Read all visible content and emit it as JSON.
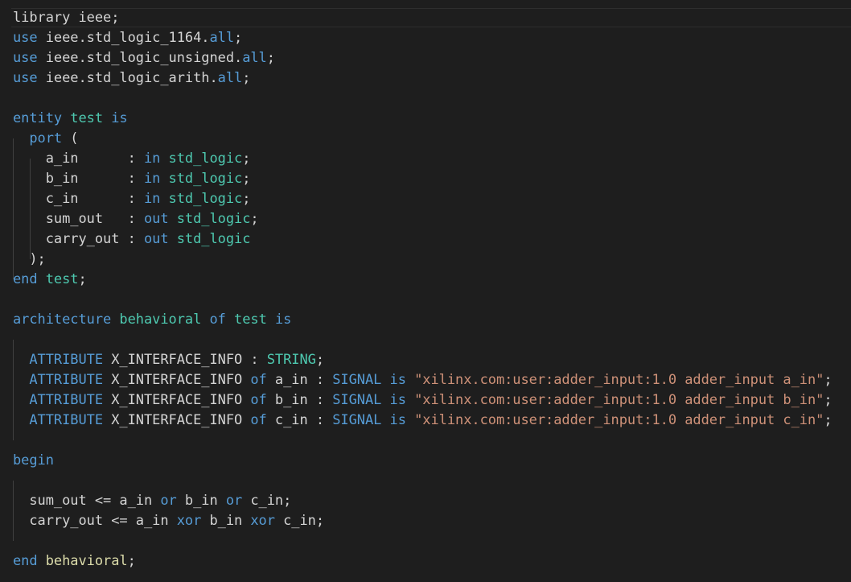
{
  "colors": {
    "background": "#1e1e1e",
    "text": "#d4d4d4",
    "keyword": "#569cd6",
    "type": "#4ec9b0",
    "string": "#ce9178",
    "function_name": "#dcdcaa"
  },
  "code": {
    "lines": [
      [
        [
          "tx",
          "library ieee;"
        ]
      ],
      [
        [
          "kw",
          "use"
        ],
        [
          "tx",
          " ieee.std_logic_1164."
        ],
        [
          "kw",
          "all"
        ],
        [
          "tx",
          ";"
        ]
      ],
      [
        [
          "kw",
          "use"
        ],
        [
          "tx",
          " ieee.std_logic_unsigned."
        ],
        [
          "kw",
          "all"
        ],
        [
          "tx",
          ";"
        ]
      ],
      [
        [
          "kw",
          "use"
        ],
        [
          "tx",
          " ieee.std_logic_arith."
        ],
        [
          "kw",
          "all"
        ],
        [
          "tx",
          ";"
        ]
      ],
      [],
      [
        [
          "kw",
          "entity"
        ],
        [
          "tx",
          " "
        ],
        [
          "ty",
          "test"
        ],
        [
          "tx",
          " "
        ],
        [
          "kw",
          "is"
        ]
      ],
      [
        [
          "tx",
          "  "
        ],
        [
          "kw",
          "port"
        ],
        [
          "tx",
          " ("
        ]
      ],
      [
        [
          "tx",
          "    a_in      : "
        ],
        [
          "kw",
          "in"
        ],
        [
          "tx",
          " "
        ],
        [
          "ty",
          "std_logic"
        ],
        [
          "tx",
          ";"
        ]
      ],
      [
        [
          "tx",
          "    b_in      : "
        ],
        [
          "kw",
          "in"
        ],
        [
          "tx",
          " "
        ],
        [
          "ty",
          "std_logic"
        ],
        [
          "tx",
          ";"
        ]
      ],
      [
        [
          "tx",
          "    c_in      : "
        ],
        [
          "kw",
          "in"
        ],
        [
          "tx",
          " "
        ],
        [
          "ty",
          "std_logic"
        ],
        [
          "tx",
          ";"
        ]
      ],
      [
        [
          "tx",
          "    sum_out   : "
        ],
        [
          "kw",
          "out"
        ],
        [
          "tx",
          " "
        ],
        [
          "ty",
          "std_logic"
        ],
        [
          "tx",
          ";"
        ]
      ],
      [
        [
          "tx",
          "    carry_out : "
        ],
        [
          "kw",
          "out"
        ],
        [
          "tx",
          " "
        ],
        [
          "ty",
          "std_logic"
        ]
      ],
      [
        [
          "tx",
          "  );"
        ]
      ],
      [
        [
          "kw",
          "end"
        ],
        [
          "tx",
          " "
        ],
        [
          "ty",
          "test"
        ],
        [
          "tx",
          ";"
        ]
      ],
      [],
      [
        [
          "kw",
          "architecture"
        ],
        [
          "tx",
          " "
        ],
        [
          "ty",
          "behavioral"
        ],
        [
          "tx",
          " "
        ],
        [
          "kw",
          "of"
        ],
        [
          "tx",
          " "
        ],
        [
          "ty",
          "test"
        ],
        [
          "tx",
          " "
        ],
        [
          "kw",
          "is"
        ]
      ],
      [],
      [
        [
          "tx",
          "  "
        ],
        [
          "kw",
          "ATTRIBUTE"
        ],
        [
          "tx",
          " X_INTERFACE_INFO : "
        ],
        [
          "ty",
          "STRING"
        ],
        [
          "tx",
          ";"
        ]
      ],
      [
        [
          "tx",
          "  "
        ],
        [
          "kw",
          "ATTRIBUTE"
        ],
        [
          "tx",
          " X_INTERFACE_INFO "
        ],
        [
          "kw",
          "of"
        ],
        [
          "tx",
          " a_in : "
        ],
        [
          "kw",
          "SIGNAL"
        ],
        [
          "tx",
          " "
        ],
        [
          "kw",
          "is"
        ],
        [
          "tx",
          " "
        ],
        [
          "st",
          "\"xilinx.com:user:adder_input:1.0 adder_input a_in\""
        ],
        [
          "tx",
          ";"
        ]
      ],
      [
        [
          "tx",
          "  "
        ],
        [
          "kw",
          "ATTRIBUTE"
        ],
        [
          "tx",
          " X_INTERFACE_INFO "
        ],
        [
          "kw",
          "of"
        ],
        [
          "tx",
          " b_in : "
        ],
        [
          "kw",
          "SIGNAL"
        ],
        [
          "tx",
          " "
        ],
        [
          "kw",
          "is"
        ],
        [
          "tx",
          " "
        ],
        [
          "st",
          "\"xilinx.com:user:adder_input:1.0 adder_input b_in\""
        ],
        [
          "tx",
          ";"
        ]
      ],
      [
        [
          "tx",
          "  "
        ],
        [
          "kw",
          "ATTRIBUTE"
        ],
        [
          "tx",
          " X_INTERFACE_INFO "
        ],
        [
          "kw",
          "of"
        ],
        [
          "tx",
          " c_in : "
        ],
        [
          "kw",
          "SIGNAL"
        ],
        [
          "tx",
          " "
        ],
        [
          "kw",
          "is"
        ],
        [
          "tx",
          " "
        ],
        [
          "st",
          "\"xilinx.com:user:adder_input:1.0 adder_input c_in\""
        ],
        [
          "tx",
          ";"
        ]
      ],
      [],
      [
        [
          "kw",
          "begin"
        ]
      ],
      [],
      [
        [
          "tx",
          "  sum_out <= a_in "
        ],
        [
          "kw",
          "or"
        ],
        [
          "tx",
          " b_in "
        ],
        [
          "kw",
          "or"
        ],
        [
          "tx",
          " c_in;"
        ]
      ],
      [
        [
          "tx",
          "  carry_out <= a_in "
        ],
        [
          "kw",
          "xor"
        ],
        [
          "tx",
          " b_in "
        ],
        [
          "kw",
          "xor"
        ],
        [
          "tx",
          " c_in;"
        ]
      ],
      [],
      [
        [
          "kw",
          "end"
        ],
        [
          "tx",
          " "
        ],
        [
          "nm",
          "behavioral"
        ],
        [
          "tx",
          ";"
        ]
      ]
    ]
  }
}
